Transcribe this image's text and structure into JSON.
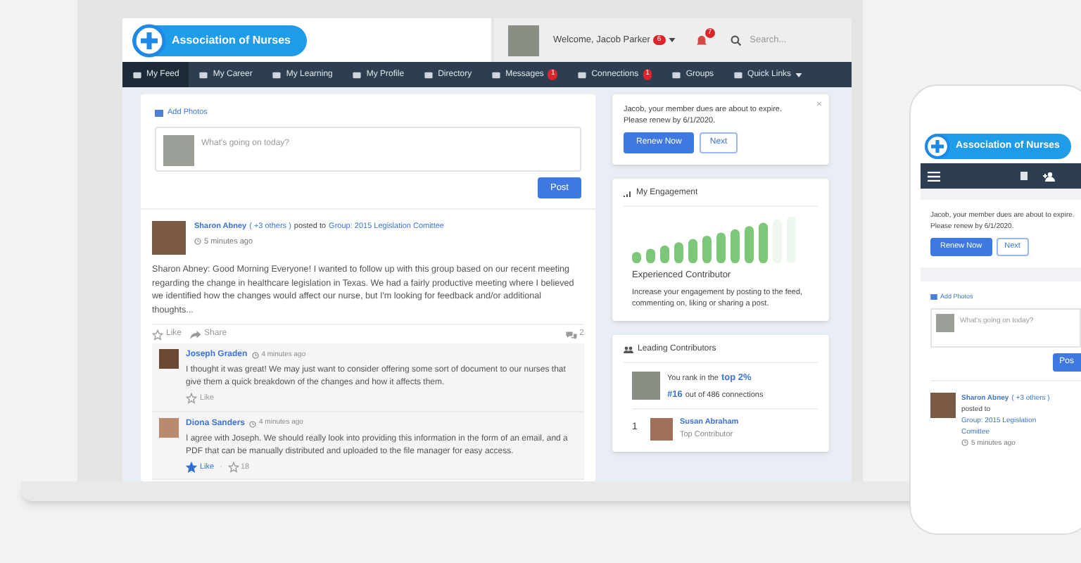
{
  "header": {
    "logo": "Association of Nurses",
    "welcome": "Welcome, Jacob Parker",
    "welcome_badge": "6",
    "bell_badge": "7",
    "search_placeholder": "Search..."
  },
  "nav": [
    {
      "label": "My Feed",
      "selected": true
    },
    {
      "label": "My Career",
      "selected": false
    },
    {
      "label": "My Learning",
      "selected": false
    },
    {
      "label": "My Profile",
      "selected": false
    },
    {
      "label": "Directory",
      "selected": false
    },
    {
      "label": "Messages",
      "badge": "1",
      "selected": false
    },
    {
      "label": "Connections",
      "badge": "1",
      "selected": false
    },
    {
      "label": "Groups",
      "selected": false
    },
    {
      "label": "Quick Links",
      "dropdown": true,
      "selected": false
    }
  ],
  "composer": {
    "add_photos": "Add Photos",
    "placeholder": "What's going on today?",
    "post_button": "Post"
  },
  "post": {
    "author": "Sharon Abney",
    "others": "( +3 others )",
    "posted_to": "posted to",
    "group": "Group: 2015 Legislation Comittee",
    "time": "5 minutes ago",
    "body": "Sharon Abney: Good Morning Everyone! I wanted to follow up with this group based on our recent meeting regarding the change in healthcare legislation in Texas. We had a fairly productive meeting where I believed we identified how the changes would affect our nurse, but I'm looking for feedback and/or additional thoughts...",
    "like": "Like",
    "share": "Share",
    "comment_count": "2",
    "comments": [
      {
        "name": "Joseph Graden",
        "time": "4 minutes ago",
        "body": "I thought it was great! We may just want to consider offering some sort of document to our nurses that give them a quick breakdown of the changes and how it affects them.",
        "like": "Like",
        "liked": false
      },
      {
        "name": "Diona Sanders",
        "time": "4 minutes ago",
        "body": "I agree with Joseph. We should really look into providing this information in the form of an email, and a PDF that can be manually distributed and uploaded to the file manager for easy access.",
        "like": "Like",
        "liked": true,
        "separator": "·",
        "likes": "18"
      }
    ]
  },
  "alert": {
    "message": "Jacob, your member dues are about to expire. Please renew by 6/1/2020.",
    "close": "×",
    "primary": "Renew Now",
    "secondary": "Next"
  },
  "engagement": {
    "title": "My Engagement",
    "level": 0.83,
    "label": "Experienced Contributor",
    "description": "Increase your engagement by posting to the feed, commenting on, liking or sharing a post."
  },
  "leaders": {
    "title": "Leading Contributors",
    "rank_prefix": "You rank in the",
    "rank_highlight": "top 2%",
    "position": "#16",
    "position_suffix": "out of 486 connections",
    "entries": [
      {
        "rank": "1",
        "name": "Susan Abraham",
        "role": "Top Contributor"
      }
    ]
  },
  "phone": {
    "logo": "Association of Nurses",
    "alert": "Jacob, your member dues are about to expire. Please renew by 6/1/2020.",
    "primary": "Renew Now",
    "secondary": "Next",
    "add_photos": "Add Photos",
    "placeholder": "What's going on today?",
    "post_button": "Pos",
    "author": "Sharon Abney",
    "others": "( +3 others )",
    "posted_to": "posted to",
    "group": "Group: 2015 Legislation Comittee",
    "time": "5 minutes ago"
  }
}
